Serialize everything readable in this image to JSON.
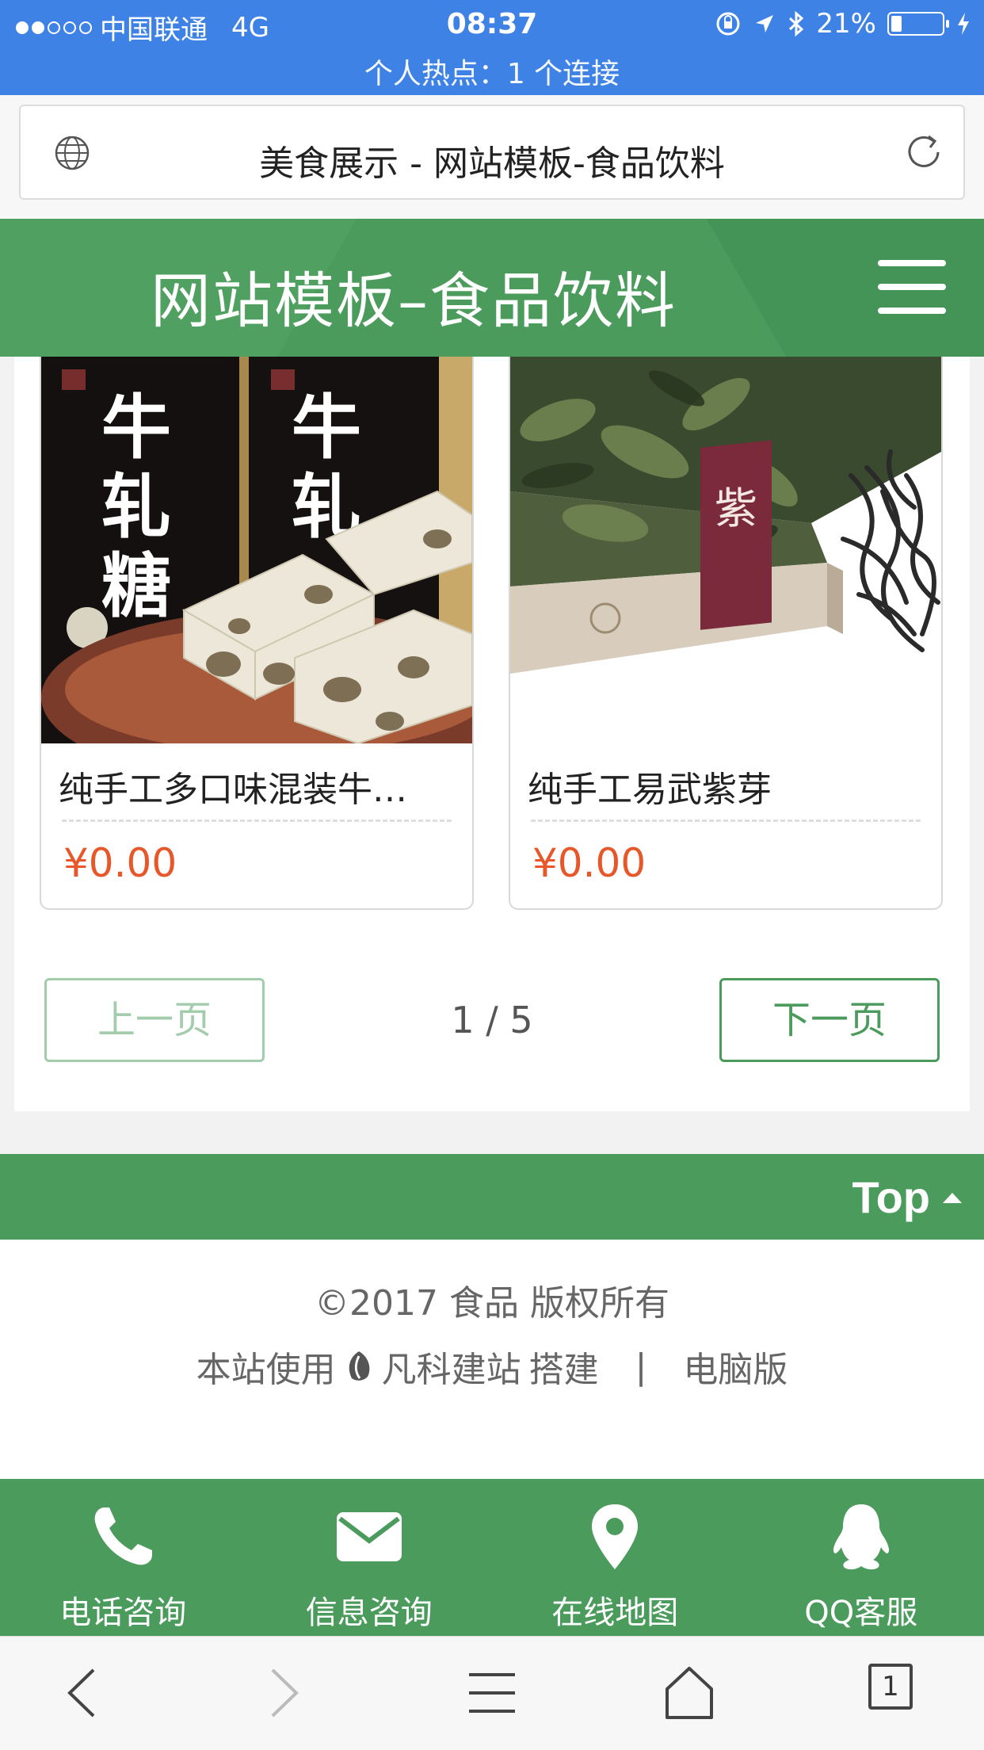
{
  "status_bar": {
    "carrier": "中国联通",
    "network": "4G",
    "time": "08:37",
    "battery": "21%",
    "battery_level": 0.21,
    "hotspot": "个人热点：1 个连接"
  },
  "browser": {
    "page_title": "美食展示 - 网站模板-食品饮料",
    "tab_count": "1"
  },
  "site": {
    "title": "网站模板–食品饮料"
  },
  "products": [
    {
      "name": "纯手工多口味混装牛…",
      "price": "¥0.00",
      "image_text": [
        "牛",
        "轧",
        "糖"
      ]
    },
    {
      "name": "纯手工易武紫芽",
      "price": "¥0.00",
      "image_text": "紫"
    }
  ],
  "pager": {
    "prev_label": "上一页",
    "next_label": "下一页",
    "info": "1 / 5"
  },
  "top_link": "Top",
  "footer": {
    "copyright": "©2017 食品 版权所有",
    "powered_prefix": "本站使用",
    "powered_brand": "凡科建站",
    "powered_suffix": "搭建",
    "desktop_label": "电脑版"
  },
  "bottom_nav": [
    {
      "label": "电话咨询",
      "icon": "phone-icon"
    },
    {
      "label": "信息咨询",
      "icon": "mail-icon"
    },
    {
      "label": "在线地图",
      "icon": "map-pin-icon"
    },
    {
      "label": "QQ客服",
      "icon": "qq-icon"
    }
  ],
  "colors": {
    "status_bar": "#3f82e6",
    "brand_green": "#4a9b5c",
    "price": "#e8572a"
  }
}
